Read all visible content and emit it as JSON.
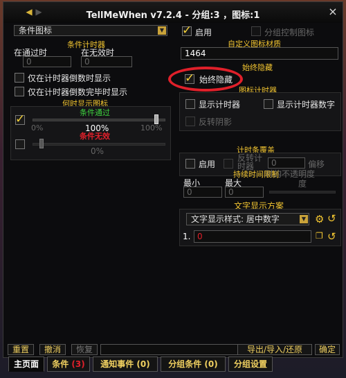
{
  "window": {
    "title": "TellMeWhen v7.2.4  - 分组:3 ，图标:1",
    "close": "×"
  },
  "left": {
    "icon_type": "条件图标",
    "cond_timer_header": "条件计时器",
    "on_valid_label": "在通过时",
    "on_valid_value": "0",
    "on_invalid_label": "在无效时",
    "on_invalid_value": "0",
    "only_countdown": "仅在计时器倒数时显示",
    "after_countdown": "仅在计时器倒数完毕时显示",
    "when_show_header": "何时显示图标",
    "cond_pass_label": "条件通过",
    "pass_min": "0%",
    "pass_max": "100%",
    "pass_value": "100%",
    "cond_fail_label": "条件无效",
    "fail_value": "0%"
  },
  "right": {
    "enable_label": "启用",
    "group_control_label": "分组控制图标",
    "custom_texture_header": "自定义图标材质",
    "texture_value": "1464",
    "always_hide_header": "始终隐藏",
    "always_hide_label": "始终隐藏",
    "icon_timer_header": "图标计时器",
    "show_timer_label": "显示计时器",
    "show_timer_number_label": "显示计时器数字",
    "reverse_shade_label": "反转阴影",
    "timer_overlay_header": "计时条覆盖",
    "overlay_enable_label": "启用",
    "reverse_timer_label": "反转计时器",
    "offset_value": "0",
    "offset_label": "偏移",
    "transparency_label": "时的不透明度",
    "duration_header": "持续时间限制",
    "min_label": "最小",
    "min_value": "0",
    "max_label": "最大",
    "max_value": "0",
    "text_display_header": "文字显示方案",
    "text_style_dropdown": "文字显示样式: 居中数字",
    "line_number": "1.",
    "line_value": "0"
  },
  "bottom_bar": {
    "reset": "重置",
    "undo": "撤消",
    "redo": "恢复",
    "export": "导出/导入/还原",
    "ok": "确定"
  },
  "tabs": [
    {
      "label": "主页面"
    },
    {
      "label": "条件 ",
      "count": "(3)"
    },
    {
      "label": "通知事件 (0)"
    },
    {
      "label": "分组条件 (0)"
    },
    {
      "label": "分组设置"
    }
  ],
  "colors": {
    "accent_gold": "#f2c531",
    "pass_green": "#3fd43f",
    "fail_red": "#e0202a"
  }
}
